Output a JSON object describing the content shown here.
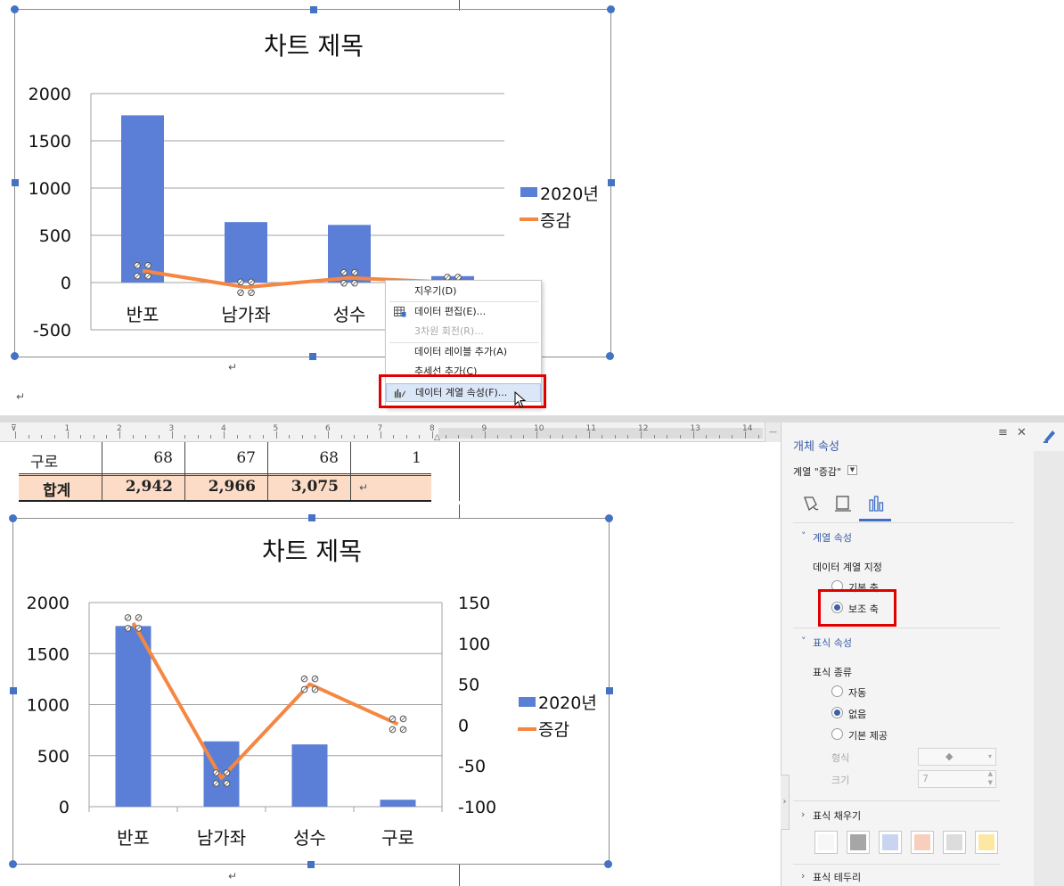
{
  "top_chart": {
    "title": "차트 제목",
    "y_ticks": [
      "2000",
      "1500",
      "1000",
      "500",
      "0",
      "-500"
    ],
    "categories_visible": [
      "반포",
      "남가좌",
      "성수"
    ],
    "legend": [
      "2020년",
      "증감"
    ]
  },
  "context_menu": {
    "items": [
      "지우기(D)",
      "데이터 편집(E)...",
      "3차원 회전(R)...",
      "데이터 레이블 추가(A)",
      "추세선 추가(C)",
      "데이터 계열 속성(F)..."
    ]
  },
  "ruler": {
    "numbers": [
      "1",
      "2",
      "3",
      "4",
      "5",
      "6",
      "7",
      "8",
      "9",
      "10",
      "11",
      "12",
      "13",
      "14"
    ]
  },
  "table": {
    "row1": [
      "구로",
      "68",
      "67",
      "68",
      "1"
    ],
    "row2": [
      "합계",
      "2,942",
      "2,966",
      "3,075",
      ""
    ]
  },
  "bottom_chart": {
    "title": "차트 제목",
    "y_ticks": [
      "2000",
      "1500",
      "1000",
      "500",
      "0"
    ],
    "y2_ticks": [
      "150",
      "100",
      "50",
      "0",
      "-50",
      "-100"
    ],
    "categories": [
      "반포",
      "남가좌",
      "성수",
      "구로"
    ],
    "legend": [
      "2020년",
      "증감"
    ]
  },
  "panel": {
    "title": "개체 속성",
    "series_select": "계열 \"증감\"",
    "section_series": "계열 속성",
    "series_assign_label": "데이터 계열 지정",
    "primary_axis": "기본 축",
    "secondary_axis": "보조 축",
    "section_marker": "표식 속성",
    "marker_type_label": "표식 종류",
    "marker_auto": "자동",
    "marker_none": "없음",
    "marker_builtin": "기본 제공",
    "shape_label": "형식",
    "size_label": "크기",
    "size_value": "7",
    "section_fill": "표식 채우기",
    "section_border": "표식 테두리",
    "swatch_colors": [
      "#f7f7f7",
      "#a6a6a6",
      "#c9d5ee",
      "#f8cfbd",
      "#dcdcdc",
      "#fce8a3"
    ]
  },
  "chart_data": [
    {
      "type": "bar",
      "title": "차트 제목",
      "categories": [
        "반포",
        "남가좌",
        "성수",
        "구로"
      ],
      "series": [
        {
          "name": "2020년",
          "type": "bar",
          "values": [
            1770,
            640,
            610,
            68
          ],
          "color": "#5b7fd6"
        },
        {
          "name": "증감",
          "type": "line",
          "values": [
            125,
            -50,
            50,
            1
          ],
          "color": "#f58742"
        }
      ],
      "ylim": [
        -500,
        2000
      ],
      "legend": "right"
    },
    {
      "type": "bar",
      "title": "차트 제목",
      "categories": [
        "반포",
        "남가좌",
        "성수",
        "구로"
      ],
      "series": [
        {
          "name": "2020년",
          "type": "bar",
          "axis": "primary",
          "values": [
            1770,
            640,
            610,
            68
          ],
          "color": "#5b7fd6"
        },
        {
          "name": "증감",
          "type": "line",
          "axis": "secondary",
          "values": [
            125,
            -65,
            50,
            1
          ],
          "color": "#f58742"
        }
      ],
      "ylim": [
        0,
        2000
      ],
      "y2lim": [
        -100,
        150
      ],
      "legend": "right"
    }
  ]
}
